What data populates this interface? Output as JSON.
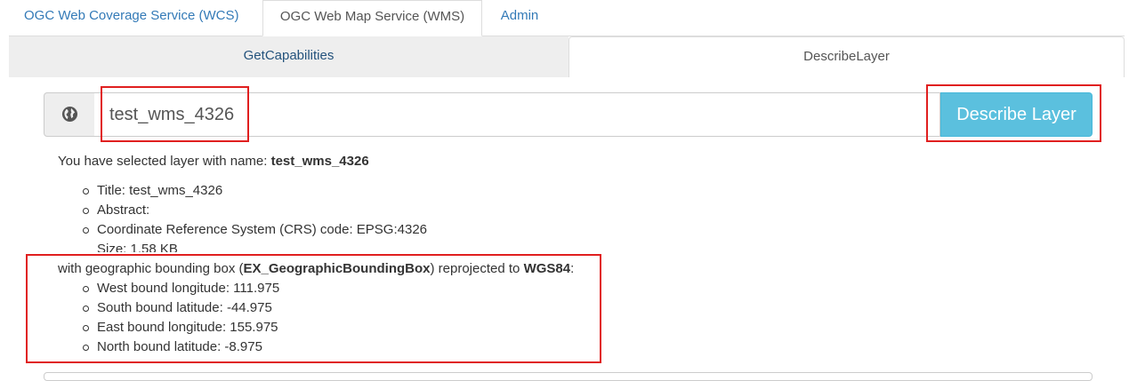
{
  "top_tabs": [
    {
      "label": "OGC Web Coverage Service (WCS)"
    },
    {
      "label": "OGC Web Map Service (WMS)"
    },
    {
      "label": "Admin"
    }
  ],
  "sub_tabs": [
    {
      "label": "GetCapabilities"
    },
    {
      "label": "DescribeLayer"
    }
  ],
  "input": {
    "value": "test_wms_4326",
    "addon_icon": "globe-icon"
  },
  "describe_button": {
    "label": "Describe Layer"
  },
  "selection": {
    "prefix": "You have selected layer with name: ",
    "layer_name": "test_wms_4326"
  },
  "properties": [
    "Title: test_wms_4326",
    "Abstract:",
    "Coordinate Reference System (CRS) code: EPSG:4326",
    "Size: 1.58 KB"
  ],
  "bbox": {
    "prefix": "with geographic bounding box (",
    "box_name": "EX_GeographicBoundingBox",
    "middle": ") reprojected to ",
    "crs": "WGS84",
    "suffix": ":",
    "items": [
      "West bound longitude: 111.975",
      "South bound latitude: -44.975",
      "East bound longitude: 155.975",
      "North bound latitude: -8.975"
    ]
  },
  "colors": {
    "link": "#337ab7",
    "info_button": "#5bc0de",
    "highlight": "#e01f1f"
  }
}
